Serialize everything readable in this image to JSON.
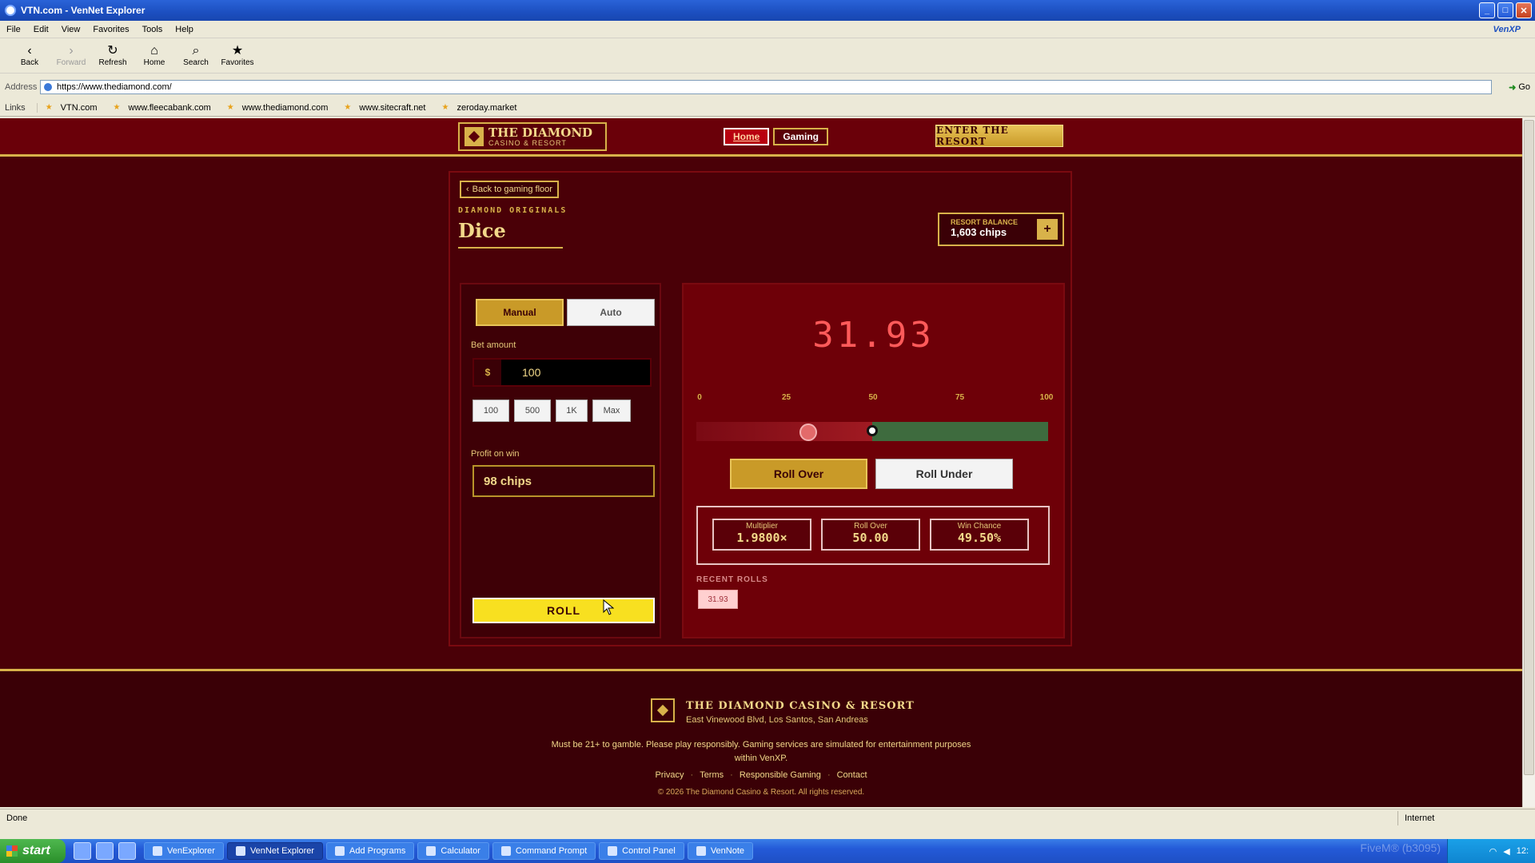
{
  "window": {
    "title": "VTN.com - VenNet Explorer"
  },
  "menu": [
    "File",
    "Edit",
    "View",
    "Favorites",
    "Tools",
    "Help"
  ],
  "menu_brand": "VenXP",
  "toolbar": {
    "back": "Back",
    "forward": "Forward",
    "refresh": "Refresh",
    "home": "Home",
    "search": "Search",
    "favorites": "Favorites"
  },
  "address": {
    "label": "Address",
    "url": "https://www.thediamond.com/",
    "go": "Go"
  },
  "links": {
    "label": "Links",
    "items": [
      "VTN.com",
      "www.fleecabank.com",
      "www.thediamond.com",
      "www.sitecraft.net",
      "zeroday.market"
    ]
  },
  "site": {
    "logo_name": "THE DIAMOND",
    "logo_sub": "CASINO & RESORT",
    "nav_home": "Home",
    "nav_gaming": "Gaming",
    "enter": "ENTER THE RESORT"
  },
  "game": {
    "back": "Back to gaming floor",
    "eyebrow": "DIAMOND ORIGINALS",
    "title": "Dice",
    "balance_label": "RESORT BALANCE",
    "balance_value": "1,603 chips",
    "balance_add": "+",
    "mode_manual": "Manual",
    "mode_auto": "Auto",
    "bet_label": "Bet amount",
    "bet_currency": "$",
    "bet_value": "100",
    "quick": [
      "100",
      "500",
      "1K",
      "Max"
    ],
    "profit_label": "Profit on win",
    "profit_value": "98 chips",
    "roll": "ROLL",
    "result": "31.93",
    "result_value": 31.93,
    "threshold": 50,
    "scale": [
      "0",
      "25",
      "50",
      "75",
      "100"
    ],
    "roll_over": "Roll Over",
    "roll_under": "Roll Under",
    "stats": [
      {
        "label": "Multiplier",
        "value": "1.9800×"
      },
      {
        "label": "Roll Over",
        "value": "50.00"
      },
      {
        "label": "Win Chance",
        "value": "49.50%"
      }
    ],
    "recent_label": "RECENT ROLLS",
    "recent": [
      "31.93"
    ]
  },
  "footer": {
    "name": "THE DIAMOND CASINO & RESORT",
    "address": "East Vinewood Blvd, Los Santos, San Andreas",
    "note": "Must be 21+ to gamble. Please play responsibly. Gaming services are simulated for entertainment purposes within VenXP.",
    "links": [
      "Privacy",
      "Terms",
      "Responsible Gaming",
      "Contact"
    ],
    "copyright": "© 2026 The Diamond Casino & Resort. All rights reserved."
  },
  "status": {
    "left": "Done",
    "zone": "Internet"
  },
  "taskbar": {
    "start": "start",
    "tasks": [
      "VenExplorer",
      "VenNet Explorer",
      "Add Programs",
      "Calculator",
      "Command Prompt",
      "Control Panel",
      "VenNote"
    ],
    "watermark": "FiveM® (b3095)",
    "clock": "12:"
  },
  "colors": {
    "accent_gold": "#d8b24a",
    "page_bg": "#4a0007",
    "result_red": "#ff5a5a",
    "win_green": "#3e6b3e",
    "roll_yellow": "#f8e020"
  }
}
